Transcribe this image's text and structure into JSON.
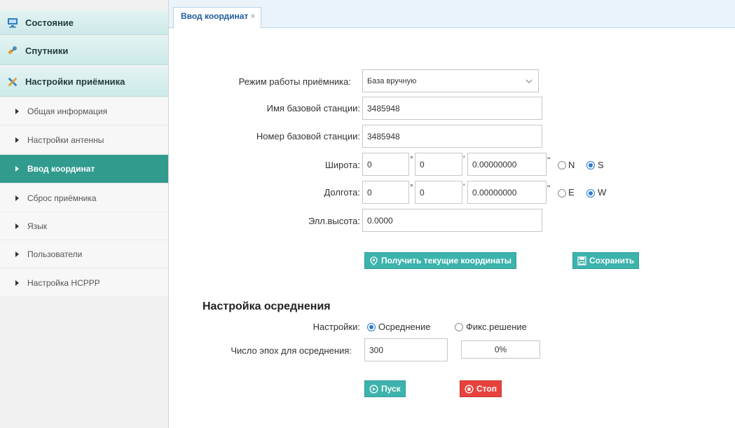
{
  "sidebar": {
    "sections": [
      {
        "label": "Состояние",
        "icon": "monitor-icon"
      },
      {
        "label": "Спутники",
        "icon": "satellite-icon"
      },
      {
        "label": "Настройки приёмника",
        "icon": "tools-icon"
      }
    ],
    "items": [
      {
        "label": "Общая информация"
      },
      {
        "label": "Настройки антенны"
      },
      {
        "label": "Ввод координат",
        "active": true
      },
      {
        "label": "Сброс приёмника"
      },
      {
        "label": "Язык"
      },
      {
        "label": "Пользователи"
      },
      {
        "label": "Настройка НСРРР"
      }
    ]
  },
  "tabs": [
    {
      "label": "Ввод координат",
      "close": "×"
    }
  ],
  "form": {
    "mode": {
      "label": "Режим работы приёмника:",
      "value": "База вручную"
    },
    "station_name": {
      "label": "Имя базовой станции:",
      "value": "3485948"
    },
    "station_number": {
      "label": "Номер базовой станции:",
      "value": "3485948"
    },
    "latitude": {
      "label": "Широта:",
      "deg": "0",
      "min": "0",
      "sec": "0.00000000",
      "deg_unit": "°",
      "min_unit": "'",
      "sec_unit": "\"",
      "opt1": "N",
      "opt2": "S",
      "selected": "S"
    },
    "longitude": {
      "label": "Долгота:",
      "deg": "0",
      "min": "0",
      "sec": "0.00000000",
      "deg_unit": "°",
      "min_unit": "'",
      "sec_unit": "\"",
      "opt1": "E",
      "opt2": "W",
      "selected": "W"
    },
    "height": {
      "label": "Элл.высота:",
      "value": "0.0000"
    },
    "get_coords_button": "Получить текущие координаты",
    "save_button": "Сохранить"
  },
  "averaging": {
    "title": "Настройка осреднения",
    "settings_label": "Настройки:",
    "opt1": "Осреднение",
    "opt2": "Фикс.решение",
    "selected": "Осреднение",
    "epochs_label": "Число эпох для осреднения:",
    "epochs_value": "300",
    "progress_text": "0%",
    "progress_fraction": 0,
    "start_button": "Пуск",
    "stop_button": "Стоп"
  },
  "colors": {
    "accent": "#3cb3ac",
    "active_item": "#319b8e",
    "stop": "#e8423d",
    "radio": "#2b7bd2"
  }
}
